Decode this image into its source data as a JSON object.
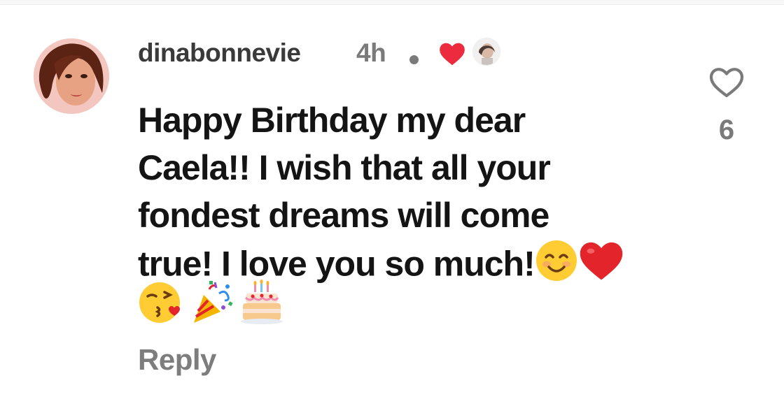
{
  "comment": {
    "username": "dinabonnevie",
    "timestamp": "4h",
    "text_lines": [
      "Happy Birthday my dear",
      "Caela!! I wish that all your",
      "fondest dreams will come",
      "true! I love you so much!"
    ],
    "inline_emojis": [
      "smiling-face-with-smiling-eyes",
      "red-heart"
    ],
    "emoji_row": [
      "face-blowing-a-kiss",
      "party-popper",
      "birthday-cake"
    ],
    "creator_liked": true,
    "reply_label": "Reply"
  },
  "likes": {
    "count": "6",
    "icon": "heart-outline-icon"
  },
  "colors": {
    "username": "#3a3a3a",
    "secondary": "#7a7a7a",
    "body_text": "#141414",
    "heart_red": "#ed2b3f"
  }
}
